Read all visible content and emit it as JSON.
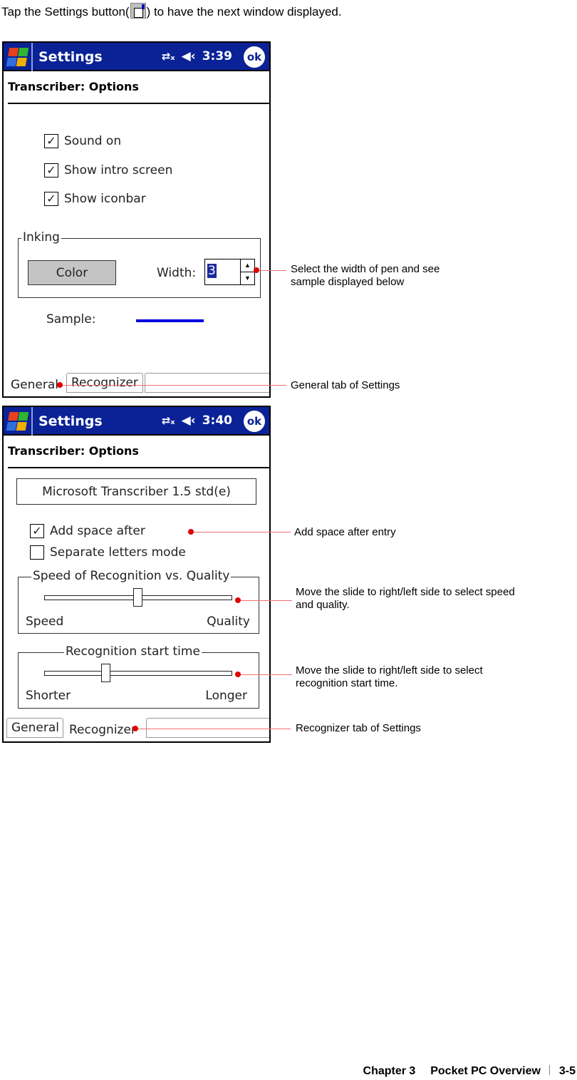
{
  "intro": {
    "before": "Tap the Settings button(",
    "icon": "settings-icon",
    "after": ") to have the next window displayed."
  },
  "screens": [
    {
      "titlebar": {
        "title": "Settings",
        "connectivity_icon": "connectivity-icon",
        "volume_icon": "speaker-icon",
        "volume_glyph": "◀‹",
        "time": "3:39",
        "ok_label": "ok"
      },
      "heading": "Transcriber: Options",
      "checkboxes": [
        {
          "label": "Sound on",
          "checked": true
        },
        {
          "label": "Show intro screen",
          "checked": true
        },
        {
          "label": "Show iconbar",
          "checked": true
        }
      ],
      "inking": {
        "legend": "Inking",
        "color_button": "Color",
        "width_label": "Width:",
        "width_value": "3"
      },
      "sample_label": "Sample:",
      "sample_color": "#0000e0",
      "tabs": [
        {
          "label": "General",
          "active": true
        },
        {
          "label": "Recognizer",
          "active": false
        }
      ]
    },
    {
      "titlebar": {
        "title": "Settings",
        "connectivity_icon": "connectivity-icon",
        "volume_icon": "speaker-icon",
        "volume_glyph": "◀‹",
        "time": "3:40",
        "ok_label": "ok"
      },
      "heading": "Transcriber: Options",
      "version": "Microsoft Transcriber 1.5 std(e)",
      "checkboxes": [
        {
          "label": "Add space after",
          "checked": true
        },
        {
          "label": "Separate letters mode",
          "checked": false
        }
      ],
      "speed_group": {
        "legend": "Speed of Recognition vs. Quality",
        "min_label": "Speed",
        "max_label": "Quality",
        "value_fraction": 0.5
      },
      "start_group": {
        "legend": "Recognition start time",
        "min_label": "Shorter",
        "max_label": "Longer",
        "value_fraction": 0.33
      },
      "tabs": [
        {
          "label": "General",
          "active": false
        },
        {
          "label": "Recognizer",
          "active": true
        }
      ]
    }
  ],
  "callouts": {
    "width": [
      "Select the width of pen and see",
      "sample displayed below"
    ],
    "general_tab": "General tab of Settings",
    "add_space": "Add space after entry",
    "speed": [
      "Move the slide to right/left side to select speed",
      "and quality."
    ],
    "start_time": [
      "Move the slide to right/left side to select",
      "recognition start time."
    ],
    "recognizer_tab": "Recognizer tab of Settings",
    "accent_color": "#e00000"
  },
  "footer": {
    "chapter": "Chapter 3",
    "title": "Pocket PC Overview",
    "page": "3-5"
  }
}
